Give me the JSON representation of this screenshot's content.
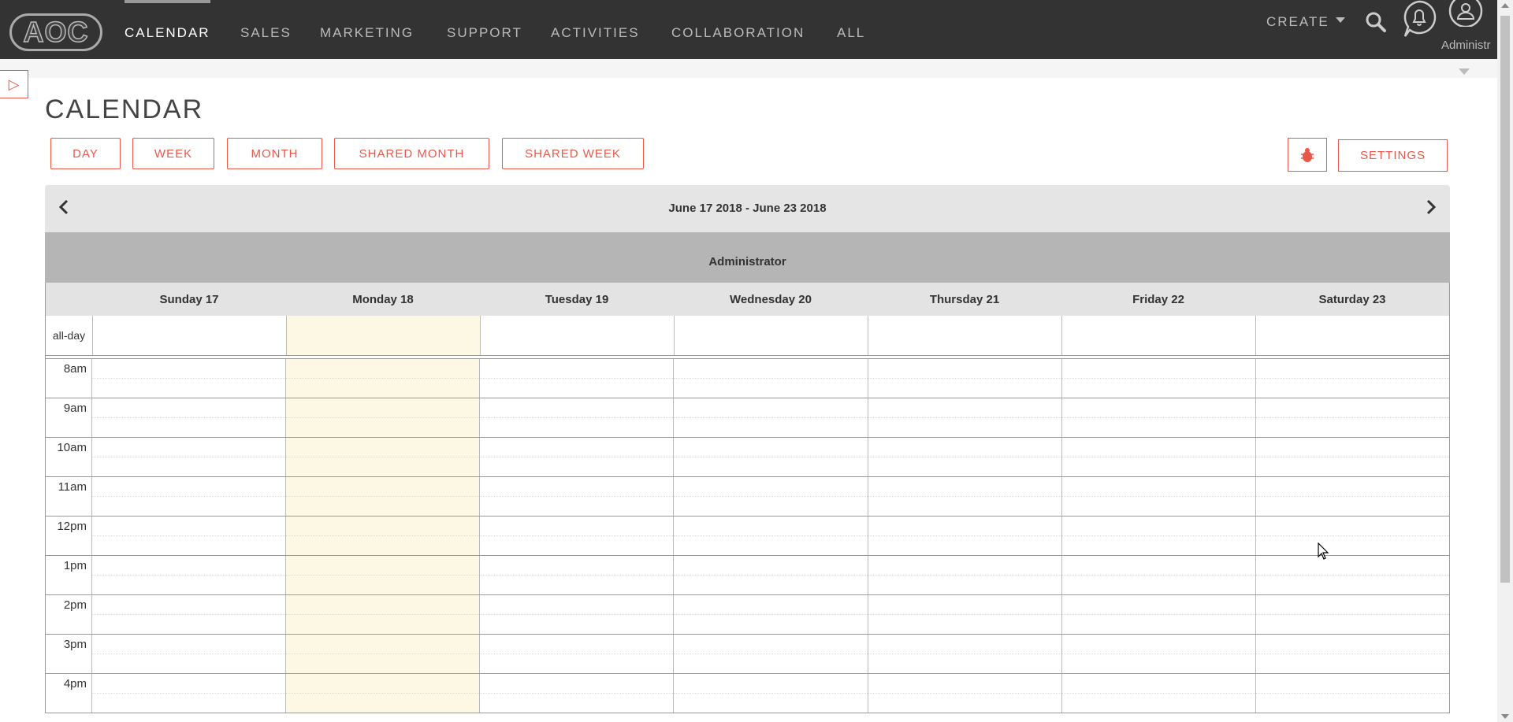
{
  "nav": {
    "logo_text": "AOC",
    "tabs": [
      {
        "label": "CALENDAR",
        "active": true
      },
      {
        "label": "SALES"
      },
      {
        "label": "MARKETING"
      },
      {
        "label": "SUPPORT"
      },
      {
        "label": "ACTIVITIES"
      },
      {
        "label": "COLLABORATION"
      },
      {
        "label": "ALL"
      }
    ],
    "create_label": "CREATE",
    "user_label": "Administr"
  },
  "page": {
    "title": "CALENDAR",
    "views": [
      "DAY",
      "WEEK",
      "MONTH",
      "SHARED MONTH",
      "SHARED WEEK"
    ],
    "settings_label": "SETTINGS"
  },
  "calendar": {
    "range": "June 17 2018 - June 23 2018",
    "resource": "Administrator",
    "days": [
      "Sunday 17",
      "Monday 18",
      "Tuesday 19",
      "Wednesday 20",
      "Thursday 21",
      "Friday 22",
      "Saturday 23"
    ],
    "today_index": 1,
    "allday_label": "all-day",
    "hours": [
      "8am",
      "9am",
      "10am",
      "11am",
      "12pm",
      "1pm",
      "2pm",
      "3pm",
      "4pm"
    ]
  },
  "colors": {
    "accent": "#e8594a",
    "nav_bg": "#333333",
    "today_bg": "#fcf8e3"
  }
}
